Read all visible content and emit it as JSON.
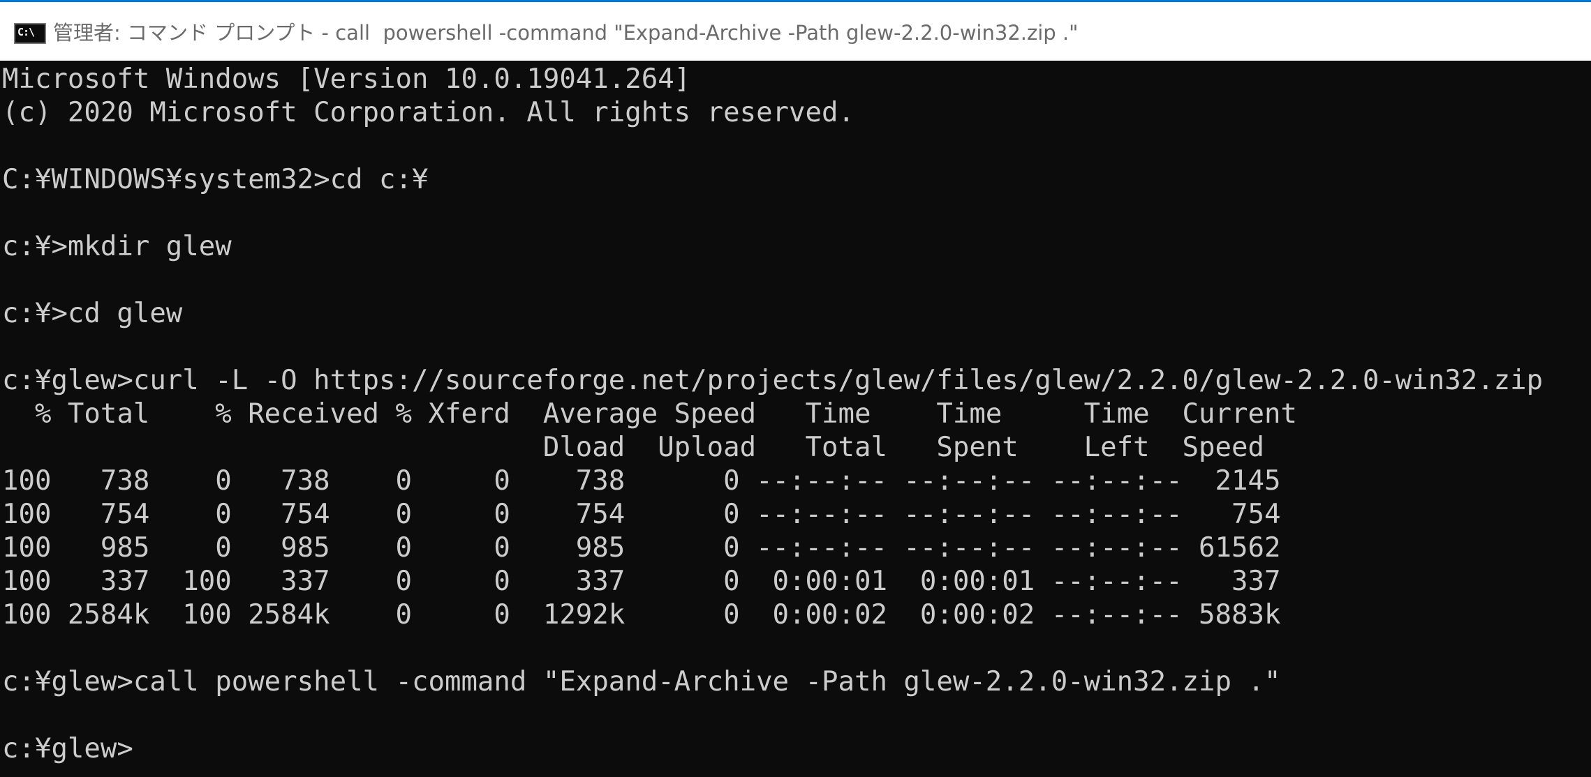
{
  "window": {
    "icon_label": "C:\\",
    "title": "管理者: コマンド プロンプト - call  powershell -command \"Expand-Archive -Path glew-2.2.0-win32.zip .\""
  },
  "console": {
    "lines": [
      "Microsoft Windows [Version 10.0.19041.264]",
      "(c) 2020 Microsoft Corporation. All rights reserved.",
      "",
      "C:¥WINDOWS¥system32>cd c:¥",
      "",
      "c:¥>mkdir glew",
      "",
      "c:¥>cd glew",
      "",
      "c:¥glew>curl -L -O https://sourceforge.net/projects/glew/files/glew/2.2.0/glew-2.2.0-win32.zip",
      "  % Total    % Received % Xferd  Average Speed   Time    Time     Time  Current",
      "                                 Dload  Upload   Total   Spent    Left  Speed",
      "100   738    0   738    0     0    738      0 --:--:-- --:--:-- --:--:--  2145",
      "100   754    0   754    0     0    754      0 --:--:-- --:--:-- --:--:--   754",
      "100   985    0   985    0     0    985      0 --:--:-- --:--:-- --:--:-- 61562",
      "100   337  100   337    0     0    337      0  0:00:01  0:00:01 --:--:--   337",
      "100 2584k  100 2584k    0     0  1292k      0  0:00:02  0:00:02 --:--:-- 5883k",
      "",
      "c:¥glew>call powershell -command \"Expand-Archive -Path glew-2.2.0-win32.zip .\"",
      "",
      "c:¥glew>"
    ]
  }
}
